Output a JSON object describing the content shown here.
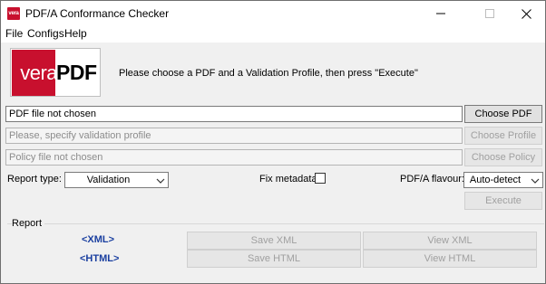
{
  "window": {
    "title": "PDF/A Conformance Checker",
    "app_icon_text": "vera"
  },
  "menu": [
    "File",
    "Configs",
    "Help"
  ],
  "logo": {
    "part1": "vera",
    "part2": "PDF",
    "accent": "#c8102e"
  },
  "instruction": "Please choose a PDF and a Validation Profile, then press \"Execute\"",
  "pdf_field": {
    "value": "PDF file not chosen",
    "button": "Choose PDF"
  },
  "profile_field": {
    "placeholder": "Please, specify validation profile",
    "button": "Choose Profile"
  },
  "policy_field": {
    "placeholder": "Policy file not chosen",
    "button": "Choose Policy"
  },
  "options": {
    "report_type_label": "Report type:",
    "report_type_value": "Validation",
    "fix_metadata_label": "Fix metadata:",
    "fix_metadata_checked": false,
    "flavour_label": "PDF/A flavour:",
    "flavour_value": "Auto-detect"
  },
  "execute_button": "Execute",
  "report": {
    "title": "Report",
    "xml_label": "<XML>",
    "html_label": "<HTML>",
    "save_xml": "Save XML",
    "view_xml": "View XML",
    "save_html": "Save HTML",
    "view_html": "View HTML"
  },
  "colors": {
    "link": "#1a3fa0",
    "disabled_text": "#a0a0a0"
  }
}
